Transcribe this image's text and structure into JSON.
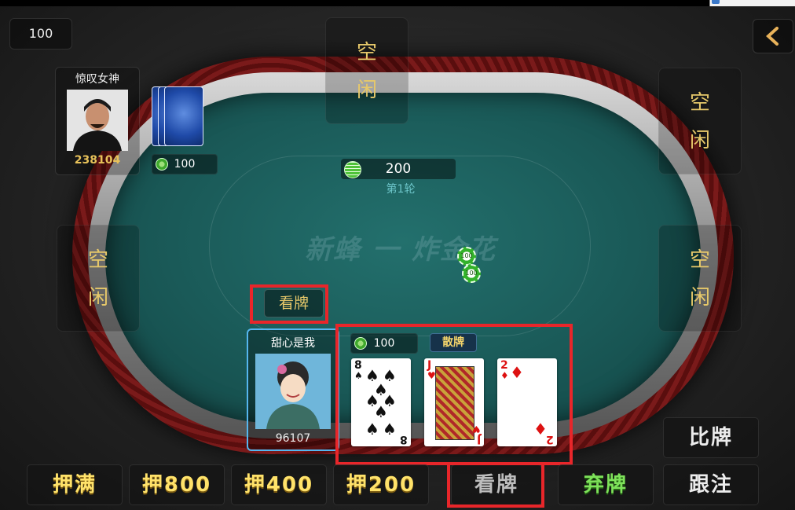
{
  "top_chip_value": "100",
  "back_button_icon": "chevron-left-icon",
  "table": {
    "watermark": "新蜂 一 炸金花",
    "pot_value": "200",
    "round_label": "第1轮",
    "center_chips": [
      "100",
      "100"
    ]
  },
  "seats": {
    "empty_char_1": "空",
    "empty_char_2": "闲"
  },
  "opponent": {
    "name": "惊叹女神",
    "score": "238104",
    "bet": "100"
  },
  "me": {
    "name": "甜心是我",
    "score": "96107",
    "bet": "100",
    "look_label": "看牌",
    "hand_type": "散牌",
    "cards": [
      {
        "rank": "8",
        "suit": "♠",
        "color": "black"
      },
      {
        "rank": "J",
        "suit": "♥",
        "color": "red"
      },
      {
        "rank": "2",
        "suit": "♦",
        "color": "red"
      }
    ]
  },
  "actions": {
    "max_bet": "押满",
    "bet_800": "押800",
    "bet_400": "押400",
    "bet_200": "押200",
    "look_cards": "看牌",
    "fold": "弃牌",
    "compare": "比牌",
    "call": "跟注"
  },
  "colors": {
    "highlight": "#e8262a",
    "gold_text": "#ffe26a",
    "seat_text": "#e6c86a",
    "fold_text": "#7ee25a",
    "me_border": "#55b6ef"
  }
}
